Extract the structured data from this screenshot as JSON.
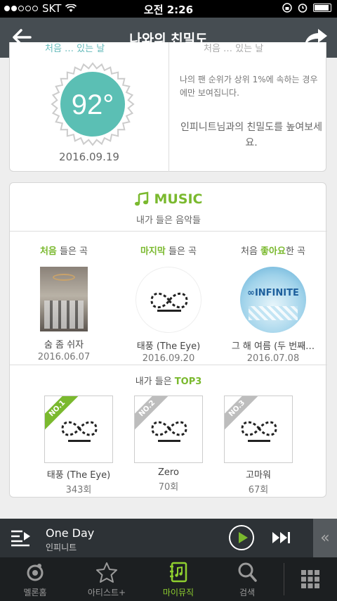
{
  "status_bar": {
    "carrier": "SKT",
    "time": "오전 2:26"
  },
  "nav": {
    "title": "나와의 친밀도",
    "back_icon": "back-arrow-icon",
    "share_icon": "share-icon"
  },
  "intimacy": {
    "partial_left": "처음 … 있는 날",
    "partial_right": "처음 … 있는 날",
    "degree": "92°",
    "date": "2016.09.19",
    "rank_note": "나의 팬 순위가 상위 1%에 속하는 경우에만 보여집니다.",
    "cta": "인피니트님과의 친밀도를 높여보세요."
  },
  "music": {
    "title": "MUSIC",
    "subtitle": "내가 들은 음악들",
    "columns": [
      {
        "head_hl": "처음",
        "head_rest": " 들은 곡",
        "head_pre": "",
        "song": "숨 좀 쉬자",
        "date": "2016.06.07"
      },
      {
        "head_hl": "마지막",
        "head_rest": " 들은 곡",
        "head_pre": "",
        "song": "태풍 (The Eye)",
        "date": "2016.09.20"
      },
      {
        "head_hl": "좋아요",
        "head_rest": "한 곡",
        "head_pre": "처음 ",
        "song": "그 해 여름 (두 번째…",
        "date": "2016.07.08"
      }
    ],
    "top3_label_pre": "내가 들은 ",
    "top3_label_hl": "TOP3",
    "top3": [
      {
        "rank": "NO.1",
        "name": "태풍 (The Eye)",
        "count": "343회"
      },
      {
        "rank": "NO.2",
        "name": "Zero",
        "count": "70회"
      },
      {
        "rank": "NO.3",
        "name": "고마워",
        "count": "67회"
      }
    ]
  },
  "player": {
    "title": "One Day",
    "artist": "인피니트"
  },
  "tabs": [
    {
      "label": "멜론홈",
      "icon": "melon-home-icon"
    },
    {
      "label": "아티스트+",
      "icon": "star-icon"
    },
    {
      "label": "마이뮤직",
      "icon": "my-music-icon"
    },
    {
      "label": "검색",
      "icon": "search-icon"
    }
  ],
  "colors": {
    "accent": "#7ab92e",
    "badge_teal": "#5bbfb4",
    "nav": "#464d52"
  }
}
